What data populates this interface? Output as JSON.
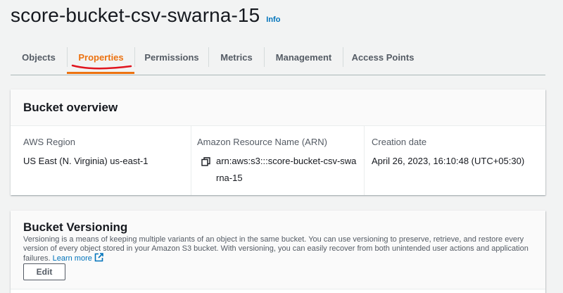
{
  "header": {
    "bucket_name": "score-bucket-csv-swarna-15",
    "info_label": "Info"
  },
  "tabs": [
    {
      "label": "Objects",
      "active": false
    },
    {
      "label": "Properties",
      "active": true
    },
    {
      "label": "Permissions",
      "active": false
    },
    {
      "label": "Metrics",
      "active": false
    },
    {
      "label": "Management",
      "active": false
    },
    {
      "label": "Access Points",
      "active": false
    }
  ],
  "overview": {
    "title": "Bucket overview",
    "region_label": "AWS Region",
    "region_value": "US East (N. Virginia) us-east-1",
    "arn_label": "Amazon Resource Name (ARN)",
    "arn_value": "arn:aws:s3:::score-bucket-csv-swarna-15",
    "creation_label": "Creation date",
    "creation_value": "April 26, 2023, 16:10:48 (UTC+05:30)"
  },
  "versioning": {
    "title": "Bucket Versioning",
    "description": "Versioning is a means of keeping multiple variants of an object in the same bucket. You can use versioning to preserve, retrieve, and restore every version of every object stored in your Amazon S3 bucket. With versioning, you can easily recover from both unintended user actions and application failures.",
    "learn_more": "Learn more",
    "edit_label": "Edit"
  },
  "colors": {
    "accent": "#ec7211",
    "link": "#0073bb",
    "annotation": "#e0141e"
  },
  "icons": {
    "copy": "copy-icon",
    "external": "external-link-icon"
  }
}
